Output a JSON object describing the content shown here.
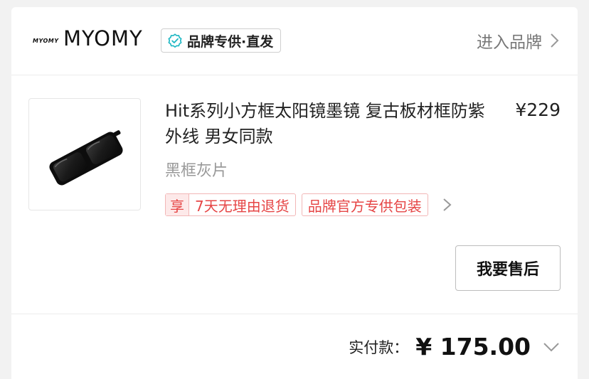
{
  "store": {
    "logo_text": "MYOMY",
    "name": "MYOMY",
    "brand_tag": "品牌专供·直发",
    "enter_label": "进入品牌"
  },
  "product": {
    "title": "Hit系列小方框太阳镜墨镜 复古板材框防紫外线 男女同款",
    "price": "¥229",
    "variant": "黑框灰片",
    "service_tags": {
      "enjoy": "享",
      "return_policy": "7天无理由退货",
      "brand_official": "品牌官方专供包装"
    }
  },
  "actions": {
    "after_sale": "我要售后"
  },
  "payment": {
    "label": "实付款：",
    "amount": "¥ 175.00"
  },
  "icons": {
    "verified": "check-circle-icon",
    "enter_chevron": "chevron-right-icon",
    "tags_chevron": "chevron-right-icon",
    "total_chevron": "chevron-down-icon"
  },
  "colors": {
    "accent_teal": "#1fb8c4",
    "tag_red": "#e64545",
    "tag_border": "#f2b7b7"
  }
}
